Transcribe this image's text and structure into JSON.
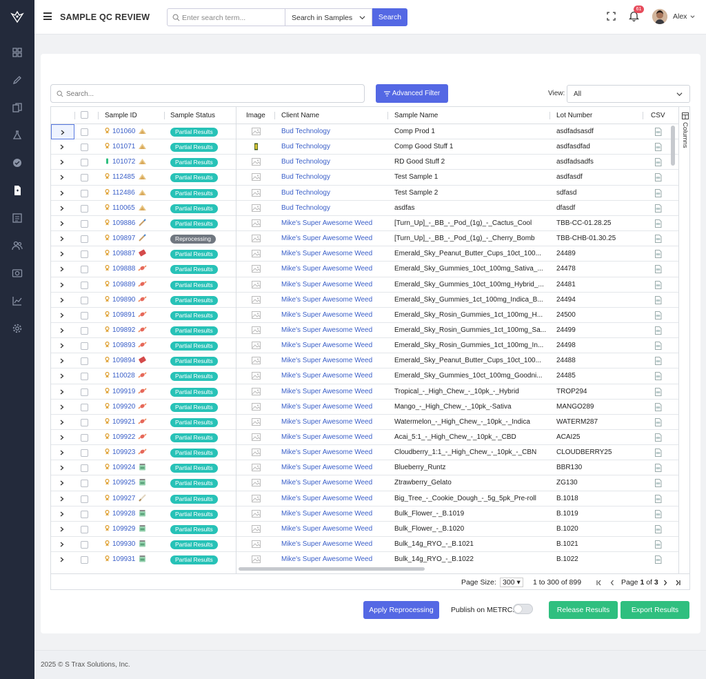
{
  "app": {
    "title": "SAMPLE QC REVIEW"
  },
  "topbar": {
    "search_placeholder": "Enter search term...",
    "scope": "Search in Samples",
    "search_label": "Search",
    "notifications": "61",
    "user": "Alex"
  },
  "sidebar": {
    "items": [
      "dashboard-icon",
      "pencil-icon",
      "copy-icon",
      "flask-icon",
      "verified-icon",
      "document-icon",
      "list-icon",
      "users-icon",
      "camera-icon",
      "chart-icon",
      "gear-icon"
    ],
    "active_index": 5
  },
  "grid": {
    "search_placeholder": "Search...",
    "advanced_filter": "Advanced Filter",
    "view_label": "View:",
    "view_value": "All",
    "columns_label": "Columns",
    "headers": {
      "sample_id": "Sample ID",
      "sample_status": "Sample Status",
      "image": "Image",
      "client_name": "Client Name",
      "sample_name": "Sample Name",
      "lot_number": "Lot Number",
      "csv": "CSV"
    },
    "rows": [
      {
        "id": "101060",
        "icon": "flower",
        "status": "Partial Results",
        "image": "placeholder",
        "client": "Bud Technology",
        "name": "Comp Prod 1",
        "lot": "asdfadsasdf"
      },
      {
        "id": "101071",
        "icon": "flower",
        "status": "Partial Results",
        "image": "product",
        "client": "Bud Technology",
        "name": "Comp Good Stuff 1",
        "lot": "asdfasdfad"
      },
      {
        "id": "101072",
        "icon": "flower",
        "status": "Partial Results",
        "image": "placeholder",
        "client": "Bud Technology",
        "name": "RD Good Stuff 2",
        "lot": "asdfadsadfs",
        "pin": "vial"
      },
      {
        "id": "112485",
        "icon": "flower",
        "status": "Partial Results",
        "image": "placeholder",
        "client": "Bud Technology",
        "name": "Test Sample 1",
        "lot": "asdfasdf"
      },
      {
        "id": "112486",
        "icon": "flower",
        "status": "Partial Results",
        "image": "placeholder",
        "client": "Bud Technology",
        "name": "Test Sample 2",
        "lot": "sdfasd"
      },
      {
        "id": "110065",
        "icon": "flower",
        "status": "Partial Results",
        "image": "placeholder",
        "client": "Bud Technology",
        "name": "asdfas",
        "lot": "dfasdf"
      },
      {
        "id": "109886",
        "icon": "vape",
        "status": "Partial Results",
        "image": "placeholder",
        "client": "Mike's Super Awesome Weed",
        "name": "[Turn_Up]_-_BB_-_Pod_(1g)_-_Cactus_Cool",
        "lot": "TBB-CC-01.28.25"
      },
      {
        "id": "109897",
        "icon": "vape",
        "status": "Reprocessing",
        "image": "placeholder",
        "client": "Mike's Super Awesome Weed",
        "name": "[Turn_Up]_-_BB_-_Pod_(1g)_-_Cherry_Bomb",
        "lot": "TBB-CHB-01.30.25"
      },
      {
        "id": "109887",
        "icon": "edible",
        "status": "Partial Results",
        "image": "placeholder",
        "client": "Mike's Super Awesome Weed",
        "name": "Emerald_Sky_Peanut_Butter_Cups_10ct_100...",
        "lot": "24489"
      },
      {
        "id": "109888",
        "icon": "candy",
        "status": "Partial Results",
        "image": "placeholder",
        "client": "Mike's Super Awesome Weed",
        "name": "Emerald_Sky_Gummies_10ct_100mg_Sativa_...",
        "lot": "24478"
      },
      {
        "id": "109889",
        "icon": "candy",
        "status": "Partial Results",
        "image": "placeholder",
        "client": "Mike's Super Awesome Weed",
        "name": "Emerald_Sky_Gummies_10ct_100mg_Hybrid_...",
        "lot": "24481"
      },
      {
        "id": "109890",
        "icon": "candy",
        "status": "Partial Results",
        "image": "placeholder",
        "client": "Mike's Super Awesome Weed",
        "name": "Emerald_Sky_Gummies_1ct_100mg_Indica_B...",
        "lot": "24494"
      },
      {
        "id": "109891",
        "icon": "candy",
        "status": "Partial Results",
        "image": "placeholder",
        "client": "Mike's Super Awesome Weed",
        "name": "Emerald_Sky_Rosin_Gummies_1ct_100mg_H...",
        "lot": "24500"
      },
      {
        "id": "109892",
        "icon": "candy",
        "status": "Partial Results",
        "image": "placeholder",
        "client": "Mike's Super Awesome Weed",
        "name": "Emerald_Sky_Rosin_Gummies_1ct_100mg_Sa...",
        "lot": "24499"
      },
      {
        "id": "109893",
        "icon": "candy",
        "status": "Partial Results",
        "image": "placeholder",
        "client": "Mike's Super Awesome Weed",
        "name": "Emerald_Sky_Rosin_Gummies_1ct_100mg_In...",
        "lot": "24498"
      },
      {
        "id": "109894",
        "icon": "edible",
        "status": "Partial Results",
        "image": "placeholder",
        "client": "Mike's Super Awesome Weed",
        "name": "Emerald_Sky_Peanut_Butter_Cups_10ct_100...",
        "lot": "24488"
      },
      {
        "id": "110028",
        "icon": "candy",
        "status": "Partial Results",
        "image": "placeholder",
        "client": "Mike's Super Awesome Weed",
        "name": "Emerald_Sky_Gummies_10ct_100mg_Goodni...",
        "lot": "24485"
      },
      {
        "id": "109919",
        "icon": "candy",
        "status": "Partial Results",
        "image": "placeholder",
        "client": "Mike's Super Awesome Weed",
        "name": "Tropical_-_High_Chew_-_10pk_-_Hybrid",
        "lot": "TROP294"
      },
      {
        "id": "109920",
        "icon": "candy",
        "status": "Partial Results",
        "image": "placeholder",
        "client": "Mike's Super Awesome Weed",
        "name": "Mango_-_High_Chew_-_10pk_-Sativa",
        "lot": "MANGO289"
      },
      {
        "id": "109921",
        "icon": "candy",
        "status": "Partial Results",
        "image": "placeholder",
        "client": "Mike's Super Awesome Weed",
        "name": "Watermelon_-_High_Chew_-_10pk_-_Indica",
        "lot": "WATERM287"
      },
      {
        "id": "109922",
        "icon": "candy",
        "status": "Partial Results",
        "image": "placeholder",
        "client": "Mike's Super Awesome Weed",
        "name": "Acai_5:1_-_High_Chew_-_10pk_-_CBD",
        "lot": "ACAI25"
      },
      {
        "id": "109923",
        "icon": "candy",
        "status": "Partial Results",
        "image": "placeholder",
        "client": "Mike's Super Awesome Weed",
        "name": "Cloudberry_1:1_-_High_Chew_-_10pk_-_CBN",
        "lot": "CLOUDBERRY25"
      },
      {
        "id": "109924",
        "icon": "jar",
        "status": "Partial Results",
        "image": "placeholder",
        "client": "Mike's Super Awesome Weed",
        "name": "Blueberry_Runtz",
        "lot": "BBR130"
      },
      {
        "id": "109925",
        "icon": "jar",
        "status": "Partial Results",
        "image": "placeholder",
        "client": "Mike's Super Awesome Weed",
        "name": "Ztrawberry_Gelato",
        "lot": "ZG130"
      },
      {
        "id": "109927",
        "icon": "preroll",
        "status": "Partial Results",
        "image": "placeholder",
        "client": "Mike's Super Awesome Weed",
        "name": "Big_Tree_-_Cookie_Dough_-_5g_5pk_Pre-roll",
        "lot": "B.1018"
      },
      {
        "id": "109928",
        "icon": "jar",
        "status": "Partial Results",
        "image": "placeholder",
        "client": "Mike's Super Awesome Weed",
        "name": "Bulk_Flower_-_B.1019",
        "lot": "B.1019"
      },
      {
        "id": "109929",
        "icon": "jar",
        "status": "Partial Results",
        "image": "placeholder",
        "client": "Mike's Super Awesome Weed",
        "name": "Bulk_Flower_-_B.1020",
        "lot": "B.1020"
      },
      {
        "id": "109930",
        "icon": "jar",
        "status": "Partial Results",
        "image": "placeholder",
        "client": "Mike's Super Awesome Weed",
        "name": "Bulk_14g_RYO_-_B.1021",
        "lot": "B.1021"
      },
      {
        "id": "109931",
        "icon": "jar",
        "status": "Partial Results",
        "image": "placeholder",
        "client": "Mike's Super Awesome Weed",
        "name": "Bulk_14g_RYO_-_B.1022",
        "lot": "B.1022"
      }
    ]
  },
  "pager": {
    "page_size_label": "Page Size:",
    "page_size": "300",
    "range": "1 to 300 of 899",
    "page_word": "Page",
    "current_page": "1",
    "of_word": "of",
    "total_pages": "3"
  },
  "actions": {
    "apply": "Apply Reprocessing",
    "publish_label": "Publish on METRC:",
    "publish_on": false,
    "release": "Release Results",
    "export": "Export Results"
  },
  "footer": {
    "copyright": "2025 © S Trax Solutions, Inc."
  },
  "colors": {
    "primary": "#5468e4",
    "success": "#2fbf7f",
    "partial": "#27c2b7",
    "reprocessing": "#707780",
    "link": "#3a5fc8",
    "sidebar": "#232a3b"
  }
}
